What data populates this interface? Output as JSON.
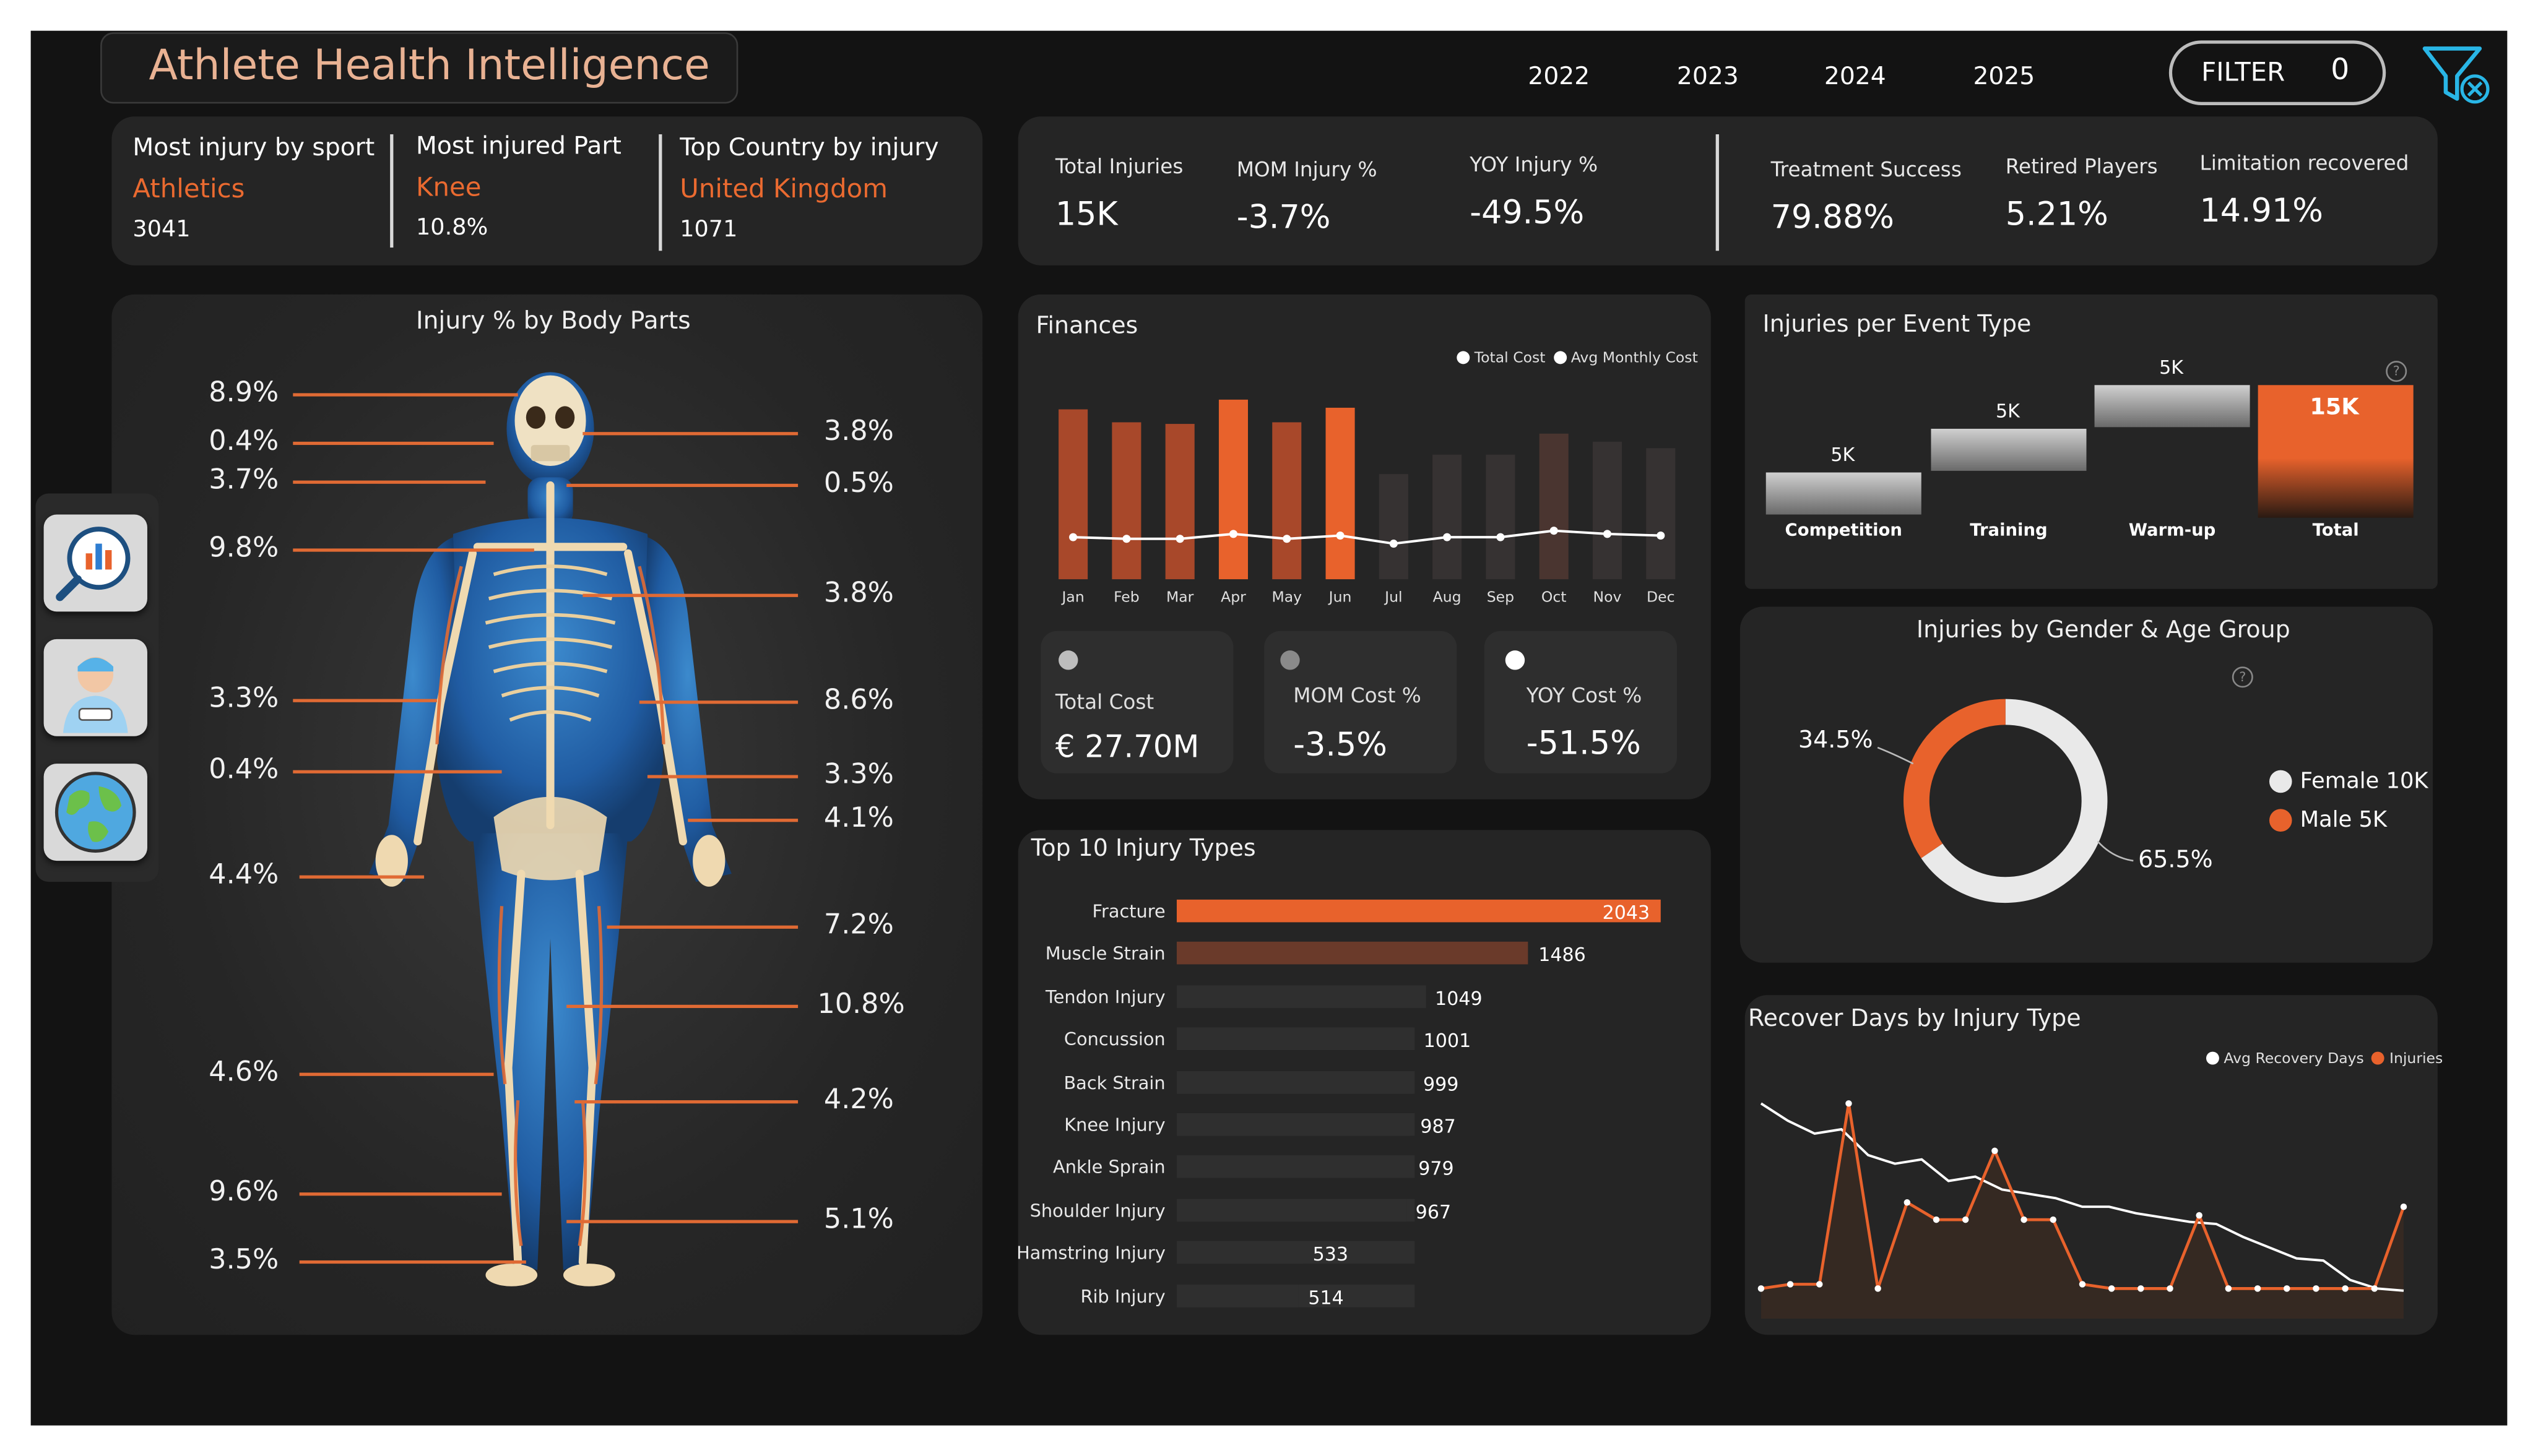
{
  "header": {
    "title": "Athlete Health Intelligence",
    "years": [
      "2022",
      "2023",
      "2024",
      "2025"
    ],
    "filter_label": "FILTER",
    "filter_count": "0"
  },
  "top_stats": {
    "sport": {
      "label": "Most injury by sport",
      "value": "Athletics",
      "count": "3041"
    },
    "part": {
      "label": "Most injured Part",
      "value": "Knee",
      "count": "10.8%"
    },
    "country": {
      "label": "Top Country by injury",
      "value": "United Kingdom",
      "count": "1071"
    }
  },
  "kpis": {
    "total_injuries": {
      "label": "Total Injuries",
      "value": "15K"
    },
    "mom_injury": {
      "label": "MOM Injury %",
      "value": "-3.7%"
    },
    "yoy_injury": {
      "label": "YOY Injury %",
      "value": "-49.5%"
    },
    "treatment_success": {
      "label": "Treatment Success",
      "value": "79.88%"
    },
    "retired_players": {
      "label": "Retired Players",
      "value": "5.21%"
    },
    "limitation_recovered": {
      "label": "Limitation recovered",
      "value": "14.91%"
    }
  },
  "body_parts": {
    "title": "Injury % by Body Parts",
    "left": [
      "8.9%",
      "0.4%",
      "3.7%",
      "9.8%",
      "3.3%",
      "0.4%",
      "4.4%",
      "4.6%",
      "9.6%",
      "3.5%"
    ],
    "right": [
      "3.8%",
      "0.5%",
      "3.8%",
      "8.6%",
      "3.3%",
      "4.1%",
      "7.2%",
      "10.8%",
      "4.2%",
      "5.1%"
    ]
  },
  "finances": {
    "title": "Finances",
    "legend": [
      "Total Cost",
      "Avg Monthly Cost"
    ],
    "cards": [
      {
        "label": "Total Cost",
        "value": "€ 27.70M"
      },
      {
        "label": "MOM Cost %",
        "value": "-3.5%"
      },
      {
        "label": "YOY Cost %",
        "value": "-51.5%"
      }
    ]
  },
  "event_type": {
    "title": "Injuries per Event Type",
    "labels": [
      "5K",
      "5K",
      "5K",
      "15K"
    ]
  },
  "gender": {
    "title": "Injuries by Gender & Age Group",
    "pct_left": "34.5%",
    "pct_right": "65.5%",
    "legend": [
      {
        "label": "Female 10K",
        "color": "#e9e9e9"
      },
      {
        "label": "Male 5K",
        "color": "#e8622c"
      }
    ]
  },
  "injury_types": {
    "title": "Top 10 Injury Types"
  },
  "recover": {
    "title": "Recover Days by Injury Type",
    "legend": [
      "Avg Recovery Days",
      "Injuries"
    ]
  },
  "colors": {
    "accent": "#e8622c",
    "bg": "#131313",
    "card": "#252525"
  },
  "chart_data": [
    {
      "type": "bar",
      "title": "Finances",
      "categories": [
        "Jan",
        "Feb",
        "Mar",
        "Apr",
        "May",
        "Jun",
        "Jul",
        "Aug",
        "Sep",
        "Oct",
        "Nov",
        "Dec"
      ],
      "series": [
        {
          "name": "Total Cost",
          "values": [
            105,
            97,
            96,
            111,
            97,
            106,
            65,
            77,
            77,
            90,
            85,
            81
          ],
          "highlight": [
            true,
            true,
            true,
            true,
            true,
            true,
            false,
            false,
            false,
            false,
            false,
            false
          ]
        },
        {
          "name": "Avg Monthly Cost",
          "values": [
            26,
            25,
            25,
            28,
            25,
            27,
            22,
            26,
            26,
            30,
            28,
            27
          ]
        }
      ]
    },
    {
      "type": "bar",
      "title": "Injuries per Event Type",
      "categories": [
        "Competition",
        "Training",
        "Warm-up",
        "Total"
      ],
      "values": [
        5,
        5,
        5,
        15
      ]
    },
    {
      "type": "pie",
      "title": "Injuries by Gender & Age Group",
      "categories": [
        "Female",
        "Male"
      ],
      "values": [
        65.5,
        34.5
      ]
    },
    {
      "type": "bar",
      "title": "Top 10 Injury Types",
      "categories": [
        "Fracture",
        "Muscle Strain",
        "Tendon Injury",
        "Concussion",
        "Back Strain",
        "Knee Injury",
        "Ankle Sprain",
        "Shoulder Injury",
        "Hamstring Injury",
        "Rib Injury"
      ],
      "values": [
        2043,
        1486,
        1049,
        1001,
        999,
        987,
        979,
        967,
        533,
        514
      ]
    },
    {
      "type": "line",
      "title": "Recover Days by Injury Type",
      "series": [
        {
          "name": "Avg Recovery Days",
          "values": [
            100,
            92,
            86,
            88,
            76,
            72,
            74,
            64,
            66,
            60,
            58,
            56,
            52,
            52,
            49,
            47,
            45,
            44,
            38,
            33,
            28,
            27,
            18,
            14,
            13
          ]
        },
        {
          "name": "Injuries",
          "values": [
            14,
            16,
            16,
            100,
            14,
            54,
            46,
            46,
            78,
            46,
            46,
            16,
            14,
            14,
            14,
            48,
            14,
            14,
            14,
            14,
            14,
            14,
            52
          ]
        }
      ]
    }
  ]
}
